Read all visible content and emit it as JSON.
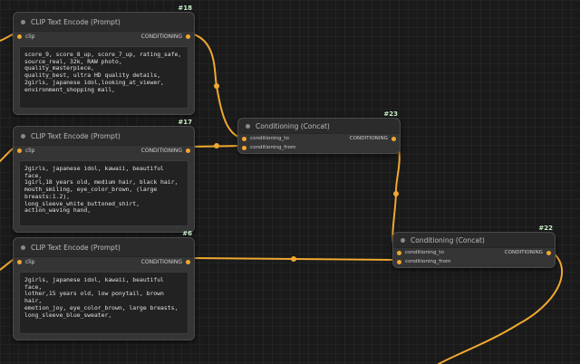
{
  "colors": {
    "wire": "#f0a830",
    "canvas": "#1a1a1a",
    "node_body": "#353535",
    "node_title": "#2b2b2b",
    "id_badge": "#c8f0c8"
  },
  "nodes": {
    "clip18": {
      "id": "#18",
      "title": "CLIP Text Encode (Prompt)",
      "input": "clip",
      "output": "CONDITIONING",
      "text": "score_9, score_8_up, score_7_up, rating_safe,\nsource_real, 32k, RAW photo, quality_masterpiece,\nquality_best, ultra HD quality details,\n2girls, japanese idol,looking_at_viewer,\nenvironment_shopping mall,"
    },
    "clip17": {
      "id": "#17",
      "title": "CLIP Text Encode (Prompt)",
      "input": "clip",
      "output": "CONDITIONING",
      "text": "2girls, japanese idol, kawaii, beautiful face,\n1girl,18 years old, medium hair, black hair,\nmouth_smiling, eye_color_brown, (large\nbreasts:1.2), long_sleeve_white_buttoned_shirt,\naction_waving hand,"
    },
    "clip6": {
      "id": "#6",
      "title": "CLIP Text Encode (Prompt)",
      "input": "clip",
      "output": "CONDITIONING",
      "text": "2girls, japanese idol, kawaii, beautiful face,\nlother,15 years old, low ponytail, brown hair,\nemotion_joy, eye_color_brown, large breasts,\nlong_sleeve_blue_sweater,"
    },
    "concat23": {
      "id": "#23",
      "title": "Conditioning (Concat)",
      "input_to": "conditioning_to",
      "input_from": "conditioning_from",
      "output": "CONDITIONING"
    },
    "concat22": {
      "id": "#22",
      "title": "Conditioning (Concat)",
      "input_to": "conditioning_to",
      "input_from": "conditioning_from",
      "output": "CONDITIONING"
    }
  }
}
